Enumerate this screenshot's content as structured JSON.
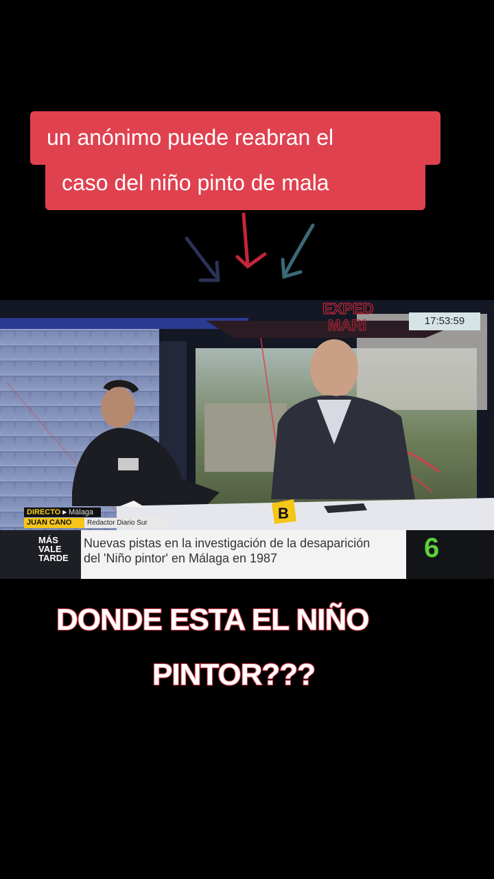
{
  "caption": {
    "line1": "un anónimo puede reabran el",
    "line2": "caso del niño pinto de mala",
    "background_color": "#e0414f"
  },
  "arrows": [
    "arrow-down-left-icon",
    "arrow-down-icon",
    "arrow-down-right-icon"
  ],
  "broadcast": {
    "clock": "17:53:59",
    "backdrop_text": [
      "EXPED",
      "MARI"
    ],
    "live_label": "DIRECTO",
    "location": "Málaga",
    "guest_name": "JUAN CANO",
    "guest_role": "Redactor Diario Sur",
    "desk_letter": "B",
    "show_logo": [
      "MÁS",
      "VALE",
      "TARDE"
    ],
    "headline_line1": "Nuevas pistas en la investigación de la desaparición",
    "headline_line2": "del 'Niño pintor' en Málaga en 1987",
    "channel": "6"
  },
  "bottom_text": {
    "line1": "DONDE ESTA EL NIÑO",
    "line2": "PINTOR???"
  }
}
